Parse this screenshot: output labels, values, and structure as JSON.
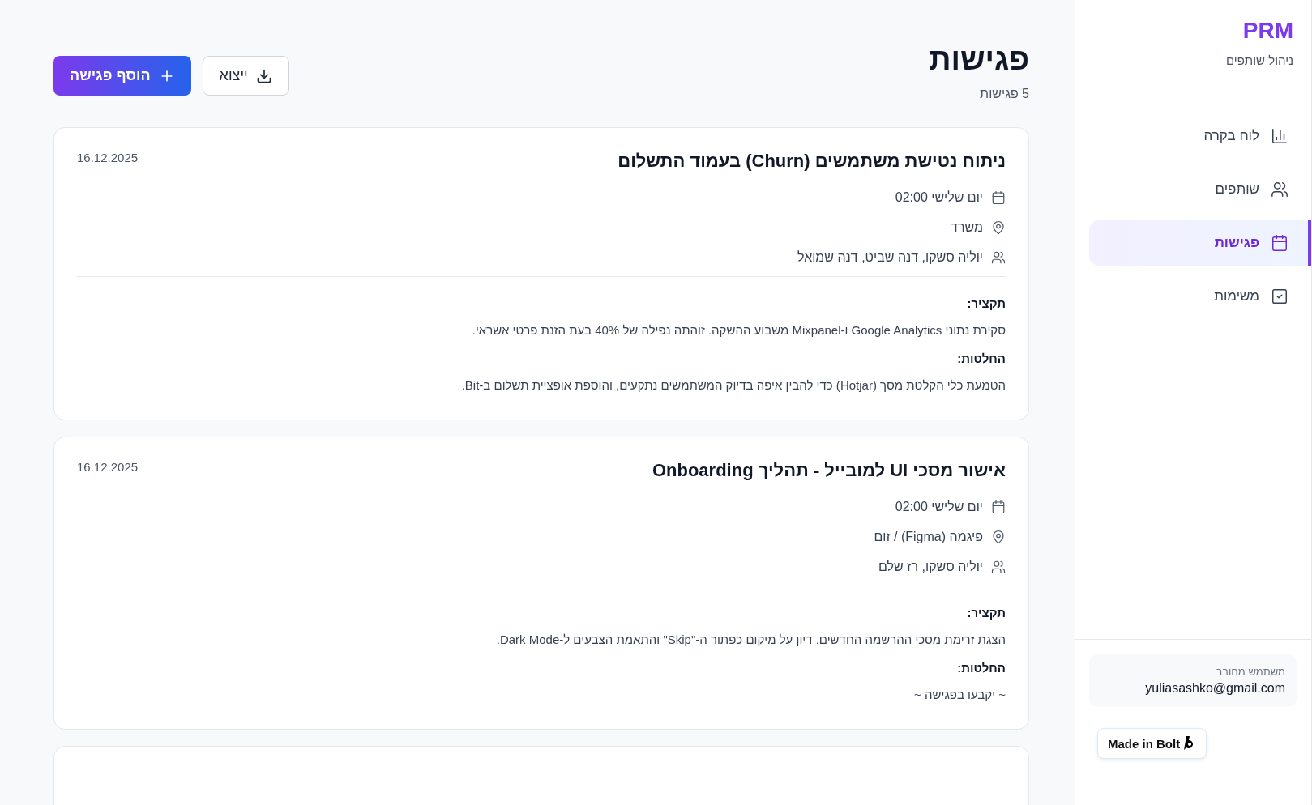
{
  "sidebar": {
    "logo": "PRM",
    "subtitle": "ניהול שותפים",
    "items": [
      {
        "label": "לוח בקרה",
        "selected": false
      },
      {
        "label": "שותפים",
        "selected": false
      },
      {
        "label": "פגישות",
        "selected": true
      },
      {
        "label": "משימות",
        "selected": false
      }
    ],
    "user": {
      "caption": "משתמש מחובר",
      "email": "yuliasashko@gmail.com"
    },
    "badge": "Made in Bolt"
  },
  "header": {
    "title": "פגישות",
    "count": "5 פגישות",
    "export_button": "ייצוא",
    "add_button": "הוסף פגישה"
  },
  "meetings": [
    {
      "title": "ניתוח נטישת משתמשים (Churn) בעמוד התשלום",
      "date": "16.12.2025",
      "time": "יום שלישי 02:00",
      "location": "משרד",
      "participants": "יוליה סשקו, דנה שביט, דנה שמואל",
      "summary_label": "תקציר:",
      "summary": "סקירת נתוני Google Analytics ו-Mixpanel משבוע ההשקה. זוהתה נפילה של 40% בעת הזנת פרטי אשראי.",
      "decisions_label": "החלטות:",
      "decisions": "הטמעת כלי הקלטת מסך (Hotjar) כדי להבין איפה בדיוק המשתמשים נתקעים, והוספת אופציית תשלום ב-Bit."
    },
    {
      "title": "אישור מסכי UI למובייל - תהליך Onboarding",
      "date": "16.12.2025",
      "time": "יום שלישי 02:00",
      "location": "פיגמה (Figma) / זום",
      "participants": "יוליה סשקו, רז שלם",
      "summary_label": "תקציר:",
      "summary": "הצגת זרימת מסכי ההרשמה החדשים. דיון על מיקום כפתור ה-\"Skip\" והתאמת הצבעים ל-Dark Mode.",
      "decisions_label": "החלטות:",
      "decisions": "~ יקבעו בפגישה ~"
    }
  ]
}
